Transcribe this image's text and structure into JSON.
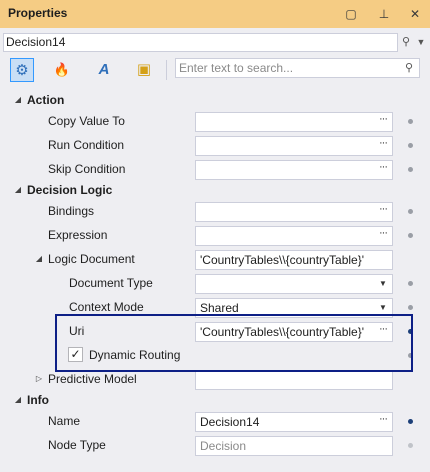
{
  "window": {
    "title": "Properties"
  },
  "title_buttons": [
    {
      "name": "maximize-icon",
      "glyph": "▢"
    },
    {
      "name": "pin-icon",
      "glyph": "⊥"
    },
    {
      "name": "close-icon",
      "glyph": "✕"
    }
  ],
  "object_selector": {
    "value": "Decision14"
  },
  "toolbar": {
    "tools": [
      {
        "name": "categorized-view-icon",
        "glyph": "⚙",
        "color": "#2f6fba"
      },
      {
        "name": "events-icon",
        "glyph": "🔥",
        "color": "#d35400"
      },
      {
        "name": "alphabetical-view-icon",
        "glyph": "A",
        "color": "#2f6fba"
      },
      {
        "name": "property-pages-icon",
        "glyph": "▣",
        "color": "#d4a017"
      }
    ]
  },
  "search": {
    "placeholder": "Enter text to search..."
  },
  "grid": {
    "action": {
      "label": "Action",
      "copy_value_to": "Copy Value To",
      "run_condition": "Run Condition",
      "skip_condition": "Skip Condition"
    },
    "decision_logic": {
      "label": "Decision Logic",
      "bindings": "Bindings",
      "expression": "Expression",
      "logic_document": {
        "label": "Logic Document",
        "value": "'CountryTables\\\\{countryTable}'"
      },
      "document_type": "Document Type",
      "context_mode": {
        "label": "Context Mode",
        "value": "Shared"
      },
      "uri": {
        "label": "Uri",
        "value": "'CountryTables\\\\{countryTable}'"
      },
      "dynamic_routing": {
        "label": "Dynamic Routing",
        "checked": true
      },
      "predictive_model": "Predictive Model"
    },
    "info": {
      "label": "Info",
      "name": {
        "label": "Name",
        "value": "Decision14"
      },
      "node_type": {
        "label": "Node Type",
        "value": "Decision"
      }
    }
  },
  "glyphs": {
    "ellipsis": "···",
    "dropdown": "▼",
    "expanded": "◢",
    "collapsed": "▷",
    "check": "✓",
    "search": "⚲"
  },
  "colors": {
    "titlebar": "#f5cc84",
    "highlight_border": "#0d1f86",
    "set_value_dot": "#1c3f78"
  }
}
